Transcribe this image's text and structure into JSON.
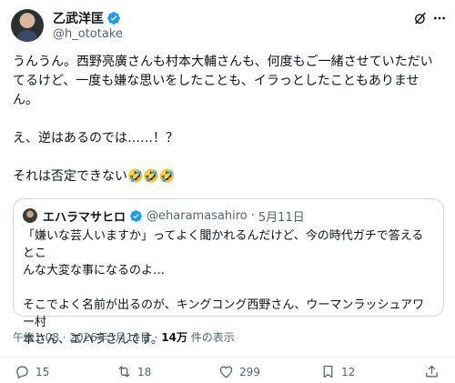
{
  "author": {
    "display_name": "乙武洋匡",
    "handle": "@h_ototake"
  },
  "icons": {
    "verified": "verified-badge-icon",
    "grok": "grok-icon",
    "more": "more-icon"
  },
  "tweet": {
    "line1": "うんうん。西野亮廣さんも村本大輔さんも、何度もご一緒させていただい",
    "line2": "てるけど、一度も嫌な思いをしたことも、イラっとしたこともありませ",
    "line3": "ん。",
    "line4": "え、逆はあるのでは……！？",
    "line5": "それは否定できない🤣🤣🤣"
  },
  "quote": {
    "name": "エハラマサヒロ",
    "handle": "@eharamasahiro",
    "separator": "·",
    "date": "5月11日",
    "line1": "「嫌いな芸人いますか」ってよく聞かれるんだけど、今の時代ガチで答えるとこ",
    "line2": "んな大変な事になるのよ…",
    "line3": "そこでよく名前が出るのが、キングコング西野さん、ウーマンラッシュアワー村",
    "line4": "本さん、エハラさんです。"
  },
  "meta": {
    "time": "午後1:08 · 2026年5月11日 · ",
    "views_count": "14万",
    "views_label": " 件の表示"
  },
  "actions": {
    "replies": "15",
    "reposts": "18",
    "likes": "299",
    "bookmarks": "12"
  },
  "colors": {
    "text": "#0f1419",
    "secondary": "#536471",
    "verified": "#1d9bf0",
    "border": "#cfd9de"
  }
}
